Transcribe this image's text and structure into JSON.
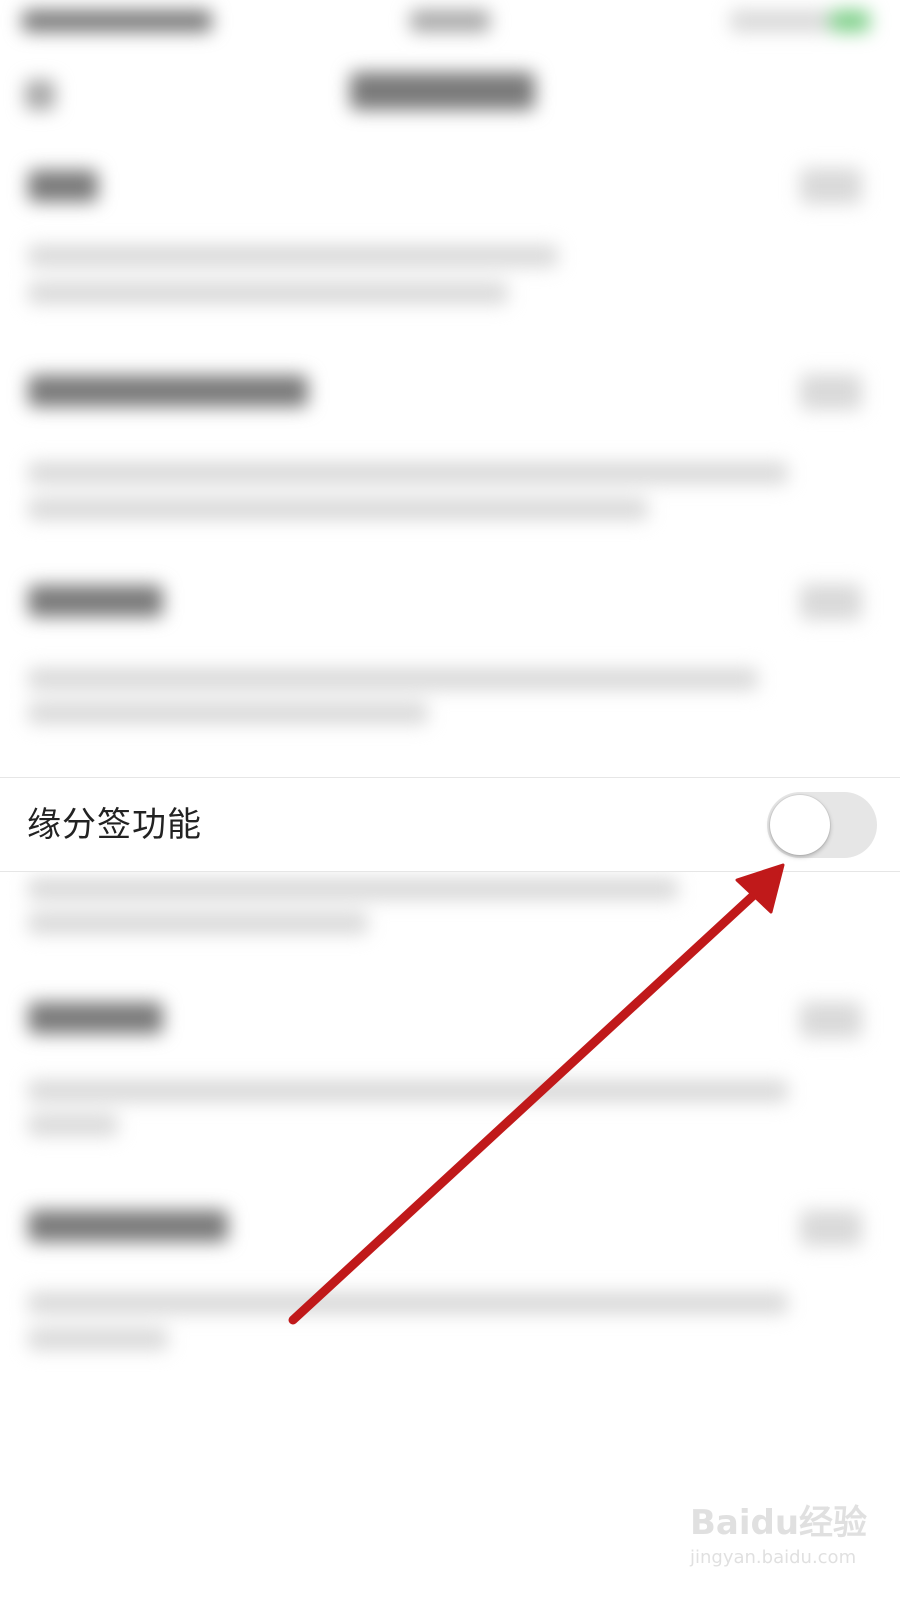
{
  "setting_row": {
    "label": "缘分签功能",
    "toggle_state": "off"
  },
  "annotation": {
    "arrow_color": "#c0191a"
  },
  "watermark": {
    "logo_text": "Baidu经验",
    "site_text": "jingyan.baidu.com"
  }
}
